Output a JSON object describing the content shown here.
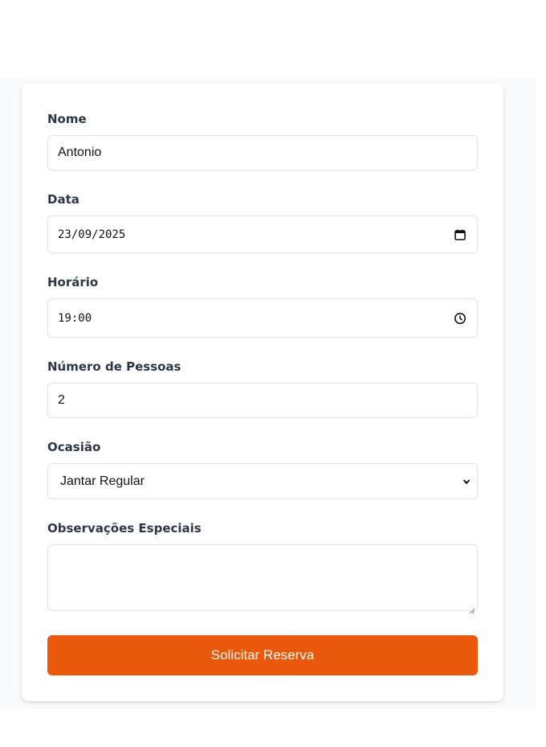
{
  "form": {
    "name": {
      "label": "Nome",
      "value": "Antonio"
    },
    "date": {
      "label": "Data",
      "value": "23/09/2025",
      "icon": "calendar-icon"
    },
    "time": {
      "label": "Horário",
      "value": "19:00",
      "icon": "clock-icon"
    },
    "guests": {
      "label": "Número de Pessoas",
      "value": "2"
    },
    "occasion": {
      "label": "Ocasião",
      "selected": "Jantar Regular",
      "icon": "chevron-down-icon"
    },
    "notes": {
      "label": "Observações Especiais",
      "value": ""
    },
    "submit_label": "Solicitar Reserva"
  },
  "colors": {
    "accent": "#ea580c",
    "page_background": "#f8fafc",
    "label": "#2d3748",
    "input_border": "#dfe3e8"
  }
}
